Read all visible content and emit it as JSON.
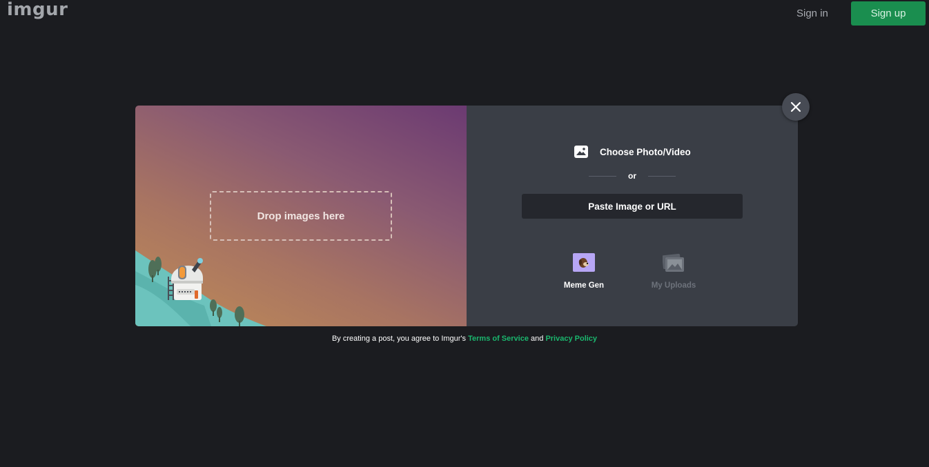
{
  "header": {
    "logo": "imgur",
    "sign_in": "Sign in",
    "sign_up": "Sign up"
  },
  "upload_modal": {
    "drop_zone_label": "Drop images here",
    "choose_label": "Choose Photo/Video",
    "or_label": "or",
    "paste_label": "Paste Image or URL",
    "tools": [
      {
        "label": "Meme Gen",
        "icon": "meme-gen-icon"
      },
      {
        "label": "My Uploads",
        "icon": "my-uploads-icon"
      }
    ],
    "close_icon": "close-icon"
  },
  "terms": {
    "prefix": "By creating a post, you agree to Imgur's",
    "terms_link": "Terms of Service",
    "conjunction": "and",
    "privacy_link": "Privacy Policy"
  },
  "colors": {
    "background": "#1b1c20",
    "accent_green": "#1bb76e",
    "signup_button": "#1a8e4f",
    "modal_right": "#3a3e46",
    "paste_button": "#25272d"
  }
}
